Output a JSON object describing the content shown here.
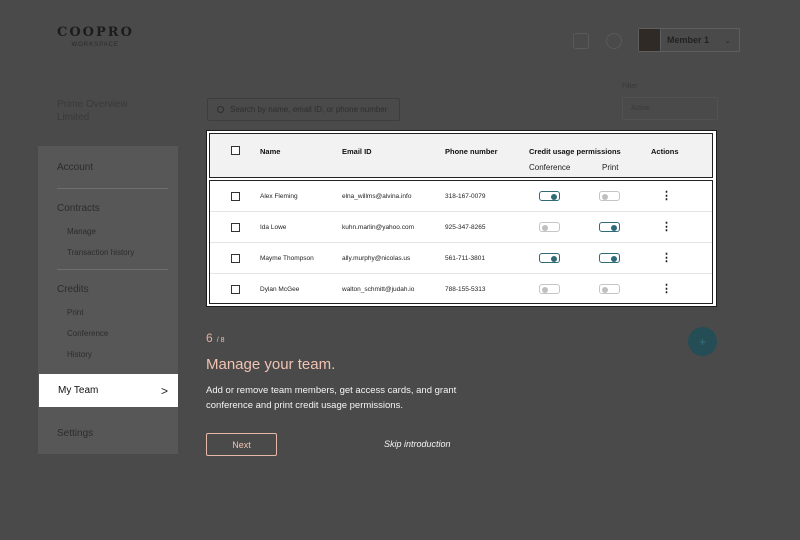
{
  "header": {
    "logo_text": "COOPRO",
    "logo_subtext": "WORKSPACE",
    "icons": [
      "calendar-icon",
      "bell-icon"
    ],
    "profile_name": "Member 1",
    "profile_chevron": "⌄"
  },
  "company": {
    "name_line1": "Prime Overview",
    "name_line2": "Limited"
  },
  "search": {
    "placeholder": "Search by name, email ID, or phone number"
  },
  "filter": {
    "label": "Filter",
    "value": "Active"
  },
  "sidebar": {
    "account": "Account",
    "contracts": "Contracts",
    "contracts_items": [
      "Manage",
      "Transaction history"
    ],
    "credits": "Credits",
    "credits_items": [
      "Print",
      "Conference",
      "History"
    ],
    "my_team": "My Team",
    "my_team_arrow": ">",
    "settings": "Settings"
  },
  "table": {
    "headers": {
      "name": "Name",
      "email": "Email ID",
      "phone": "Phone number",
      "permissions": "Credit usage permissions",
      "conference": "Conference",
      "print": "Print",
      "actions": "Actions"
    },
    "action_glyph": "⋮",
    "rows": [
      {
        "name": "Alex Fleming",
        "email": "elna_willms@alvina.info",
        "phone": "318-167-0079",
        "conference": true,
        "print": false
      },
      {
        "name": "Ida Lowe",
        "email": "kuhn.marlin@yahoo.com",
        "phone": "925-347-8265",
        "conference": false,
        "print": true
      },
      {
        "name": "Mayme Thompson",
        "email": "ally.murphy@nicolas.us",
        "phone": "561-711-3801",
        "conference": true,
        "print": true
      },
      {
        "name": "Dylan McGee",
        "email": "walton_schmitt@judah.io",
        "phone": "788-155-5313",
        "conference": false,
        "print": false
      }
    ]
  },
  "tutorial": {
    "step_current": "6",
    "step_total": "/ 8",
    "title": "Manage your team.",
    "description": "Add or remove team members, get access cards, and grant conference and print credit usage permissions.",
    "next_label": "Next",
    "skip_label": "Skip introduction"
  },
  "fab": {
    "glyph": "+"
  },
  "colors": {
    "toggle_on": "#2f6b77",
    "accent_text": "#f0c3b3",
    "overlay": "#4a4a4a"
  }
}
